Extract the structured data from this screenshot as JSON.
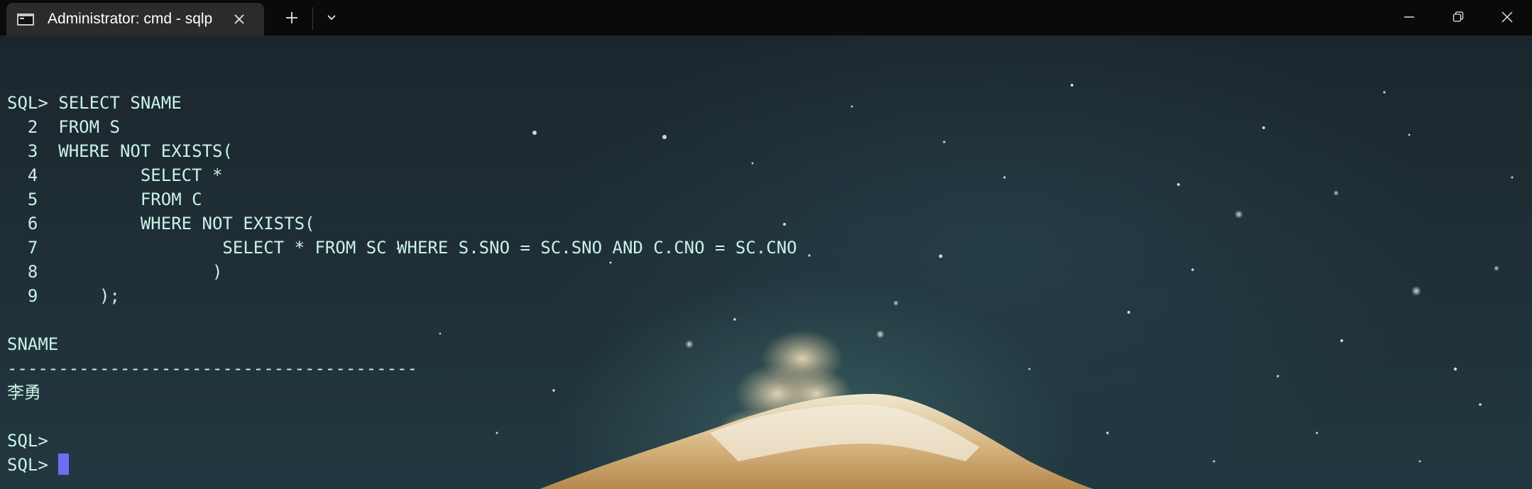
{
  "window": {
    "tab_title": "Administrator: cmd - sqlp",
    "tab_icon": "terminal-icon",
    "new_tab_icon": "plus-icon",
    "dropdown_icon": "chevron-down-icon",
    "controls": [
      "minimize-icon",
      "restore-icon",
      "close-icon"
    ]
  },
  "terminal": {
    "colors": {
      "text": "#c9f3e6",
      "cursor": "#6e6ef2",
      "titlebar": "#0a0a0a",
      "tab": "#2b2b2b"
    },
    "lines": [
      "",
      "SQL> SELECT SNAME",
      "  2  FROM S",
      "  3  WHERE NOT EXISTS(",
      "  4          SELECT *",
      "  5          FROM C",
      "  6          WHERE NOT EXISTS(",
      "  7                  SELECT * FROM SC WHERE S.SNO = SC.SNO AND C.CNO = SC.CNO",
      "  8                 )",
      "  9      );",
      "",
      "SNAME",
      "----------------------------------------",
      "李勇",
      "",
      "SQL>"
    ],
    "prompt": "SQL> "
  }
}
